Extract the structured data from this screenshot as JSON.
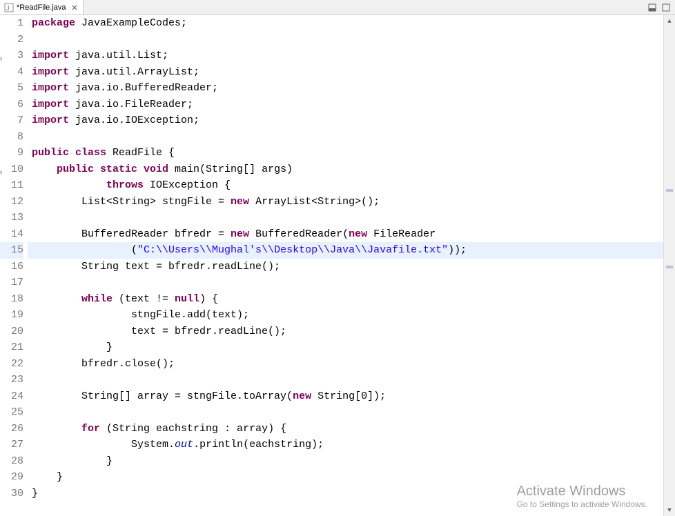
{
  "tab": {
    "title": "*ReadFile.java"
  },
  "code": {
    "l1": [
      {
        "t": "package ",
        "c": "kw"
      },
      {
        "t": "JavaExampleCodes;",
        "c": "plain"
      }
    ],
    "l2": [],
    "l3": [
      {
        "t": "import ",
        "c": "kw"
      },
      {
        "t": "java.util.List;",
        "c": "plain"
      }
    ],
    "l4": [
      {
        "t": "import ",
        "c": "kw"
      },
      {
        "t": "java.util.ArrayList;",
        "c": "plain"
      }
    ],
    "l5": [
      {
        "t": "import ",
        "c": "kw"
      },
      {
        "t": "java.io.BufferedReader;",
        "c": "plain"
      }
    ],
    "l6": [
      {
        "t": "import ",
        "c": "kw"
      },
      {
        "t": "java.io.FileReader;",
        "c": "plain"
      }
    ],
    "l7": [
      {
        "t": "import ",
        "c": "kw"
      },
      {
        "t": "java.io.IOException;",
        "c": "plain"
      }
    ],
    "l8": [],
    "l9": [
      {
        "t": "public class ",
        "c": "kw"
      },
      {
        "t": "ReadFile {",
        "c": "plain"
      }
    ],
    "l10": [
      {
        "t": "    ",
        "c": "plain"
      },
      {
        "t": "public static void ",
        "c": "kw"
      },
      {
        "t": "main(String[] args)",
        "c": "plain"
      }
    ],
    "l11": [
      {
        "t": "            ",
        "c": "plain"
      },
      {
        "t": "throws ",
        "c": "kw"
      },
      {
        "t": "IOException {",
        "c": "plain"
      }
    ],
    "l12": [
      {
        "t": "        List<String> stngFile = ",
        "c": "plain"
      },
      {
        "t": "new ",
        "c": "kw"
      },
      {
        "t": "ArrayList<String>();",
        "c": "plain"
      }
    ],
    "l13": [],
    "l14": [
      {
        "t": "        BufferedReader bfredr = ",
        "c": "plain"
      },
      {
        "t": "new ",
        "c": "kw"
      },
      {
        "t": "BufferedReader(",
        "c": "plain"
      },
      {
        "t": "new ",
        "c": "kw"
      },
      {
        "t": "FileReader",
        "c": "plain"
      }
    ],
    "l15": [
      {
        "t": "                (",
        "c": "plain"
      },
      {
        "t": "\"C:\\\\Users\\\\Mughal's\\\\Desktop\\\\Java\\\\Javafile.txt\"",
        "c": "str"
      },
      {
        "t": "));",
        "c": "plain"
      }
    ],
    "l16": [
      {
        "t": "        String text = bfredr.readLine();",
        "c": "plain"
      }
    ],
    "l17": [],
    "l18": [
      {
        "t": "        ",
        "c": "plain"
      },
      {
        "t": "while ",
        "c": "kw"
      },
      {
        "t": "(text != ",
        "c": "plain"
      },
      {
        "t": "null",
        "c": "kw"
      },
      {
        "t": ") {",
        "c": "plain"
      }
    ],
    "l19": [
      {
        "t": "                stngFile.add(text);",
        "c": "plain"
      }
    ],
    "l20": [
      {
        "t": "                text = bfredr.readLine();",
        "c": "plain"
      }
    ],
    "l21": [
      {
        "t": "            }",
        "c": "plain"
      }
    ],
    "l22": [
      {
        "t": "        bfredr.close();",
        "c": "plain"
      }
    ],
    "l23": [],
    "l24": [
      {
        "t": "        String[] array = stngFile.toArray(",
        "c": "plain"
      },
      {
        "t": "new ",
        "c": "kw"
      },
      {
        "t": "String[0]);",
        "c": "plain"
      }
    ],
    "l25": [],
    "l26": [
      {
        "t": "        ",
        "c": "plain"
      },
      {
        "t": "for ",
        "c": "kw"
      },
      {
        "t": "(String eachstring : array) {",
        "c": "plain"
      }
    ],
    "l27": [
      {
        "t": "                System.",
        "c": "plain"
      },
      {
        "t": "out",
        "c": "field"
      },
      {
        "t": ".println(eachstring);",
        "c": "plain"
      }
    ],
    "l28": [
      {
        "t": "            }",
        "c": "plain"
      }
    ],
    "l29": [
      {
        "t": "    }",
        "c": "plain"
      }
    ],
    "l30": [
      {
        "t": "}",
        "c": "plain"
      }
    ]
  },
  "lineNums": [
    "1",
    "2",
    "3",
    "4",
    "5",
    "6",
    "7",
    "8",
    "9",
    "10",
    "11",
    "12",
    "13",
    "14",
    "15",
    "16",
    "17",
    "18",
    "19",
    "20",
    "21",
    "22",
    "23",
    "24",
    "25",
    "26",
    "27",
    "28",
    "29",
    "30"
  ],
  "highlight": 15,
  "watermark": {
    "title": "Activate Windows",
    "sub": "Go to Settings to activate Windows."
  }
}
